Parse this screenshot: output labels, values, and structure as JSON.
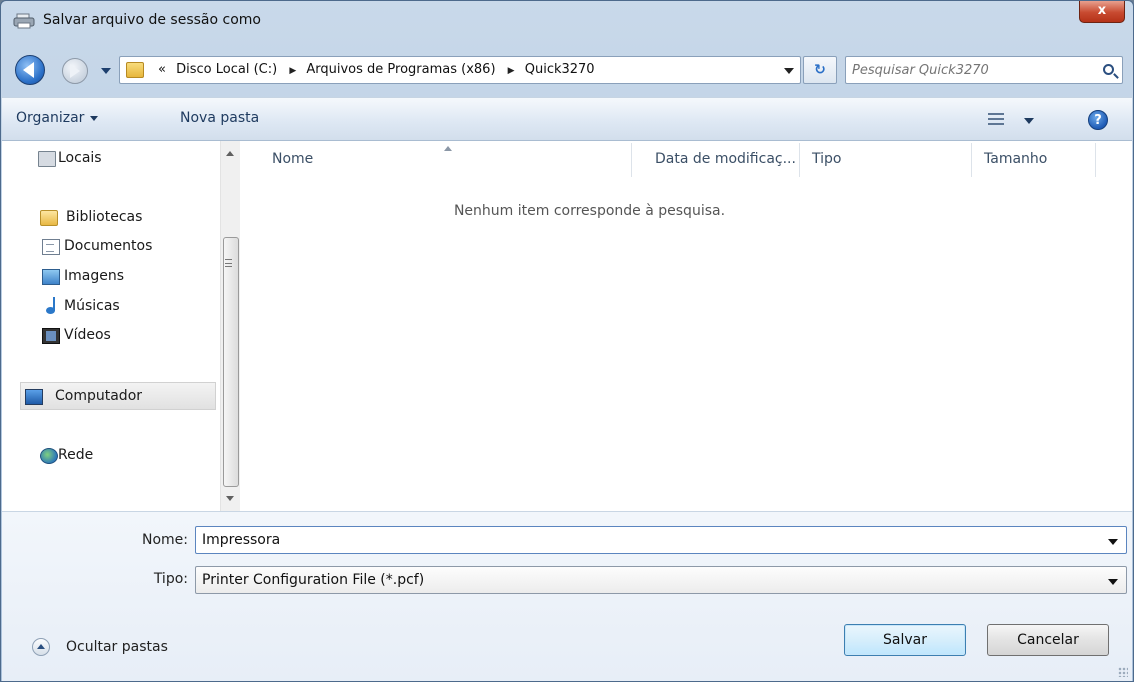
{
  "window": {
    "title": "Salvar arquivo de sessão como",
    "close_label": "x"
  },
  "nav": {
    "breadcrumb": [
      "«",
      "Disco Local (C:)",
      "Arquivos de Programas (x86)",
      "Quick3270"
    ],
    "search_placeholder": "Pesquisar Quick3270",
    "refresh_label": "↻"
  },
  "toolbar": {
    "organize_label": "Organizar",
    "new_folder_label": "Nova pasta",
    "help_label": "?"
  },
  "sidebar": {
    "items": [
      {
        "label": "Locais",
        "icon": "recent-places-icon"
      },
      {
        "label": "Bibliotecas",
        "icon": "libraries-icon"
      },
      {
        "label": "Documentos",
        "icon": "documents-icon"
      },
      {
        "label": "Imagens",
        "icon": "pictures-icon"
      },
      {
        "label": "Músicas",
        "icon": "music-icon"
      },
      {
        "label": "Vídeos",
        "icon": "videos-icon"
      },
      {
        "label": "Computador",
        "icon": "computer-icon"
      },
      {
        "label": "Rede",
        "icon": "network-icon"
      }
    ],
    "selected": "Computador"
  },
  "filelist": {
    "columns": [
      "Nome",
      "Data de modificaç...",
      "Tipo",
      "Tamanho"
    ],
    "empty_message": "Nenhum item corresponde à pesquisa."
  },
  "form": {
    "name_label": "Nome:",
    "name_value": "Impressora",
    "type_label": "Tipo:",
    "type_value": "Printer Configuration File (*.pcf)"
  },
  "footer": {
    "hide_folders_label": "Ocultar pastas",
    "save_label": "Salvar",
    "cancel_label": "Cancelar"
  },
  "colors": {
    "accent": "#2a6fc7",
    "titlebar": "#b3c8df",
    "close": "#c84a30"
  }
}
